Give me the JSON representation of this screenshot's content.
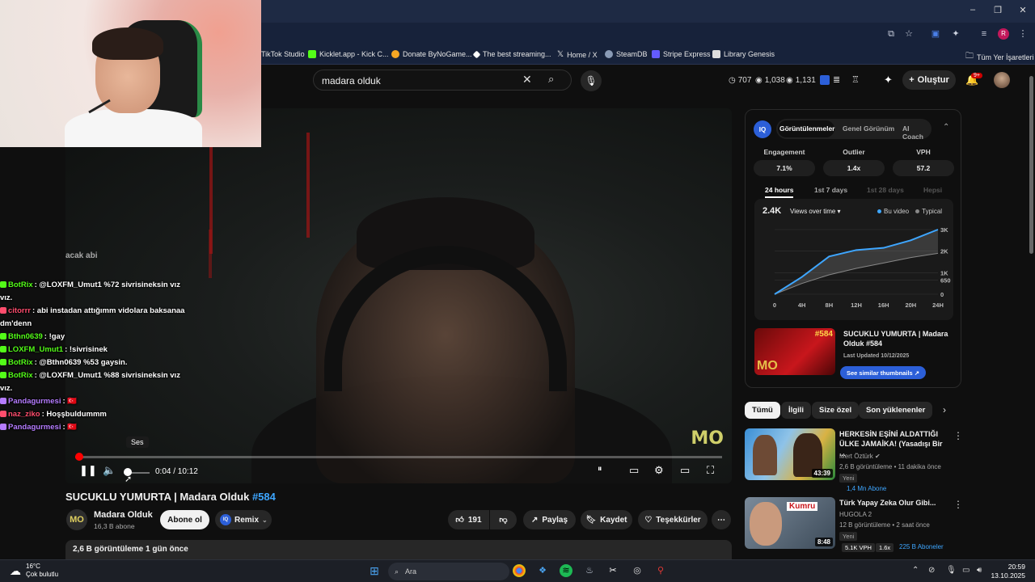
{
  "browser": {
    "bookmarks": [
      {
        "label": "TikTok Studio",
        "color": "#111111"
      },
      {
        "label": "Kicklet.app - Kick C...",
        "color": "#53fc18"
      },
      {
        "label": "Donate ByNoGame...",
        "color": "#f5a623"
      },
      {
        "label": "The best streaming...",
        "color": "#ffffff"
      },
      {
        "label": "Home / X",
        "color": "#000000"
      },
      {
        "label": "SteamDB",
        "color": "#8a9bb5"
      },
      {
        "label": "Stripe Express",
        "color": "#635bff"
      },
      {
        "label": "Library Genesis",
        "color": "#dddddd"
      }
    ],
    "all_bookmarks_label": "Tüm Yer İşaretleri",
    "profile_initial": "R"
  },
  "yt_header": {
    "search_value": "madara olduk",
    "stats": [
      "707",
      "1,038",
      "1,131"
    ],
    "create_label": "Oluştur",
    "notif_count": "9+"
  },
  "webcam": {
    "label": "streamer webcam"
  },
  "chat": {
    "ghost_text": "acak abi",
    "lines": [
      {
        "user": "BotRix",
        "user_color": "#53fc18",
        "text": ": @LOXFM_Umut1 %72 sivrisineksin vız vız."
      },
      {
        "user": "citorrr",
        "user_color": "#ff4d6d",
        "text": ": abi instadan attığımm vidolara baksanaa dm'denn"
      },
      {
        "user": "Bthn0639",
        "user_color": "#53fc18",
        "text": ": !gay"
      },
      {
        "user": "LOXFM_Umut1",
        "user_color": "#53fc18",
        "text": ": !sivrisinek"
      },
      {
        "user": "BotRix",
        "user_color": "#53fc18",
        "text": ": @Bthn0639 %53 gaysin."
      },
      {
        "user": "BotRix",
        "user_color": "#53fc18",
        "text": ": @LOXFM_Umut1 %88 sivrisineksin vız vız."
      },
      {
        "user": "Pandagurmesi",
        "user_color": "#b57cff",
        "text": ": 🇹🇷"
      },
      {
        "user": "naz_ziko",
        "user_color": "#ff4d6d",
        "text": ": Hoşşbuldummm"
      },
      {
        "user": "Pandagurmesi",
        "user_color": "#b57cff",
        "text": ": 🇹🇷"
      }
    ]
  },
  "player": {
    "time": "0:04 / 10:12",
    "progress": 0.0065,
    "volume": 0.15,
    "tooltip": "Ses",
    "watermark": "MO"
  },
  "video": {
    "title_main": "SUCUKLU YUMURTA | Madara Olduk",
    "title_hash": "#584",
    "channel_name": "Madara Olduk",
    "channel_subs": "16,3 B abone",
    "channel_avatar_text": "MO",
    "subscribe_label": "Abone ol",
    "remix_label": "Remix",
    "likes": "191",
    "share_label": "Paylaş",
    "save_label": "Kaydet",
    "thanks_label": "Teşekkürler",
    "description_meta": "2,6 B görüntüleme  1 gün önce"
  },
  "iq": {
    "logo": "IQ",
    "tabs": [
      "Görüntülenmeler",
      "Genel Görünüm",
      "AI Coach"
    ],
    "metrics": [
      {
        "label": "Engagement",
        "value": "7.1%"
      },
      {
        "label": "Outlier",
        "value": "1.4x"
      },
      {
        "label": "VPH",
        "value": "57.2"
      }
    ],
    "ranges": [
      "24 hours",
      "1st 7 days",
      "1st 28 days",
      "Hepsi"
    ],
    "chart_big": "2.4K",
    "chart_mode": "Views over time ▾",
    "legend_this": "Bu video",
    "legend_typical": "Typical",
    "legend_this_color": "#3ea6ff",
    "legend_typical_color": "#888888",
    "thumb_title": "SUCUKLU YUMURTA | Madara Olduk #584",
    "thumb_tag": "#584",
    "thumb_logo": "MO",
    "thumb_updated": "Last Updated 10/12/2025",
    "similar_label": "See similar thumbnails ↗"
  },
  "chart_data": {
    "type": "area",
    "x": [
      "0",
      "4H",
      "8H",
      "12H",
      "16H",
      "20H",
      "24H"
    ],
    "yticks": [
      "0",
      "650",
      "1K",
      "2K",
      "3K"
    ],
    "ylim": [
      0,
      3000
    ],
    "series": [
      {
        "name": "Bu video",
        "values": [
          0,
          800,
          1750,
          2050,
          2150,
          2500,
          3000
        ]
      },
      {
        "name": "Typical",
        "values": [
          0,
          500,
          900,
          1200,
          1450,
          1700,
          1900
        ]
      }
    ]
  },
  "chips": [
    "Tümü",
    "İlgili",
    "Size özel",
    "Son yüklenenler"
  ],
  "recommendations": [
    {
      "title": "HERKESİN EŞİNİ ALDATTIĞI ÜLKE JAMAİKA! (Yasadışı Bir ...",
      "channel": "Mert Öztürk ✔",
      "meta": "2,6 B görüntüleme • 11 dakika önce",
      "tag": "Yeni",
      "extra": "1,4 Mn Abone",
      "duration": "43:39"
    },
    {
      "title": "Türk Yapay Zeka Olur Gibi...",
      "channel": "HUGOLA 2",
      "meta": "12 B görüntüleme • 2 saat önce",
      "tag": "Yeni",
      "vph": "5.1K VPH",
      "mult": "1.6x",
      "extra": "225 B Aboneler",
      "duration": "8:48",
      "thumb_text": "Kumru"
    }
  ],
  "taskbar": {
    "weather_temp": "16°C",
    "weather_desc": "Çok bulutlu",
    "search_label": "Ara",
    "time": "20:59",
    "date": "13.10.2025"
  }
}
